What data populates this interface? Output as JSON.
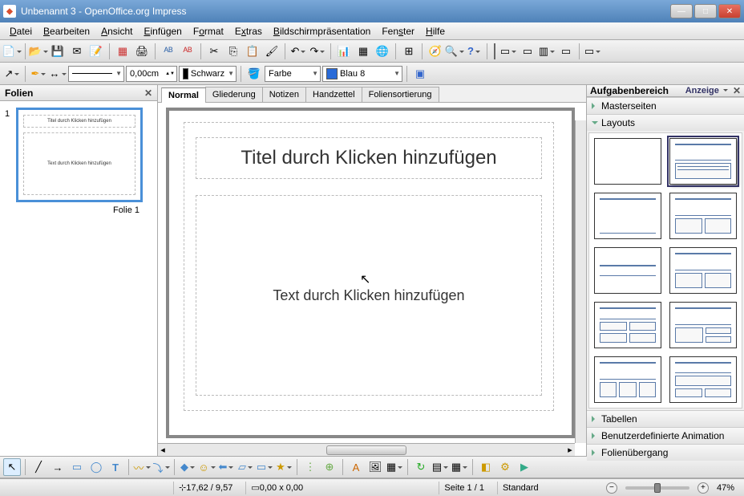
{
  "window": {
    "title": "Unbenannt 3 - OpenOffice.org Impress"
  },
  "menu": [
    "Datei",
    "Bearbeiten",
    "Ansicht",
    "Einfügen",
    "Format",
    "Extras",
    "Bildschirmpräsentation",
    "Fenster",
    "Hilfe"
  ],
  "toolbar2": {
    "width": "0,00cm",
    "linecolor_label": "Schwarz",
    "linecolor_hex": "#000000",
    "fillmode": "Farbe",
    "fillcolor_label": "Blau 8",
    "fillcolor_hex": "#2a6bd8"
  },
  "slides_panel": {
    "title": "Folien",
    "slide1_num": "1",
    "slide1_title": "Titel durch Klicken hinzufügen",
    "slide1_text": "Text durch Klicken hinzufügen",
    "slide1_label": "Folie 1"
  },
  "view_tabs": [
    "Normal",
    "Gliederung",
    "Notizen",
    "Handzettel",
    "Foliensortierung"
  ],
  "canvas": {
    "title_placeholder": "Titel durch Klicken hinzufügen",
    "content_placeholder": "Text durch Klicken hinzufügen"
  },
  "task_panel": {
    "title": "Aufgabenbereich",
    "view_label": "Anzeige",
    "sections": {
      "masterseiten": "Masterseiten",
      "layouts": "Layouts",
      "tabellen": "Tabellen",
      "animation": "Benutzerdefinierte Animation",
      "uebergang": "Folienübergang"
    }
  },
  "status": {
    "coords": "17,62 / 9,57",
    "size": "0,00 x 0,00",
    "page": "Seite 1 / 1",
    "template": "Standard",
    "zoom": "47%"
  }
}
